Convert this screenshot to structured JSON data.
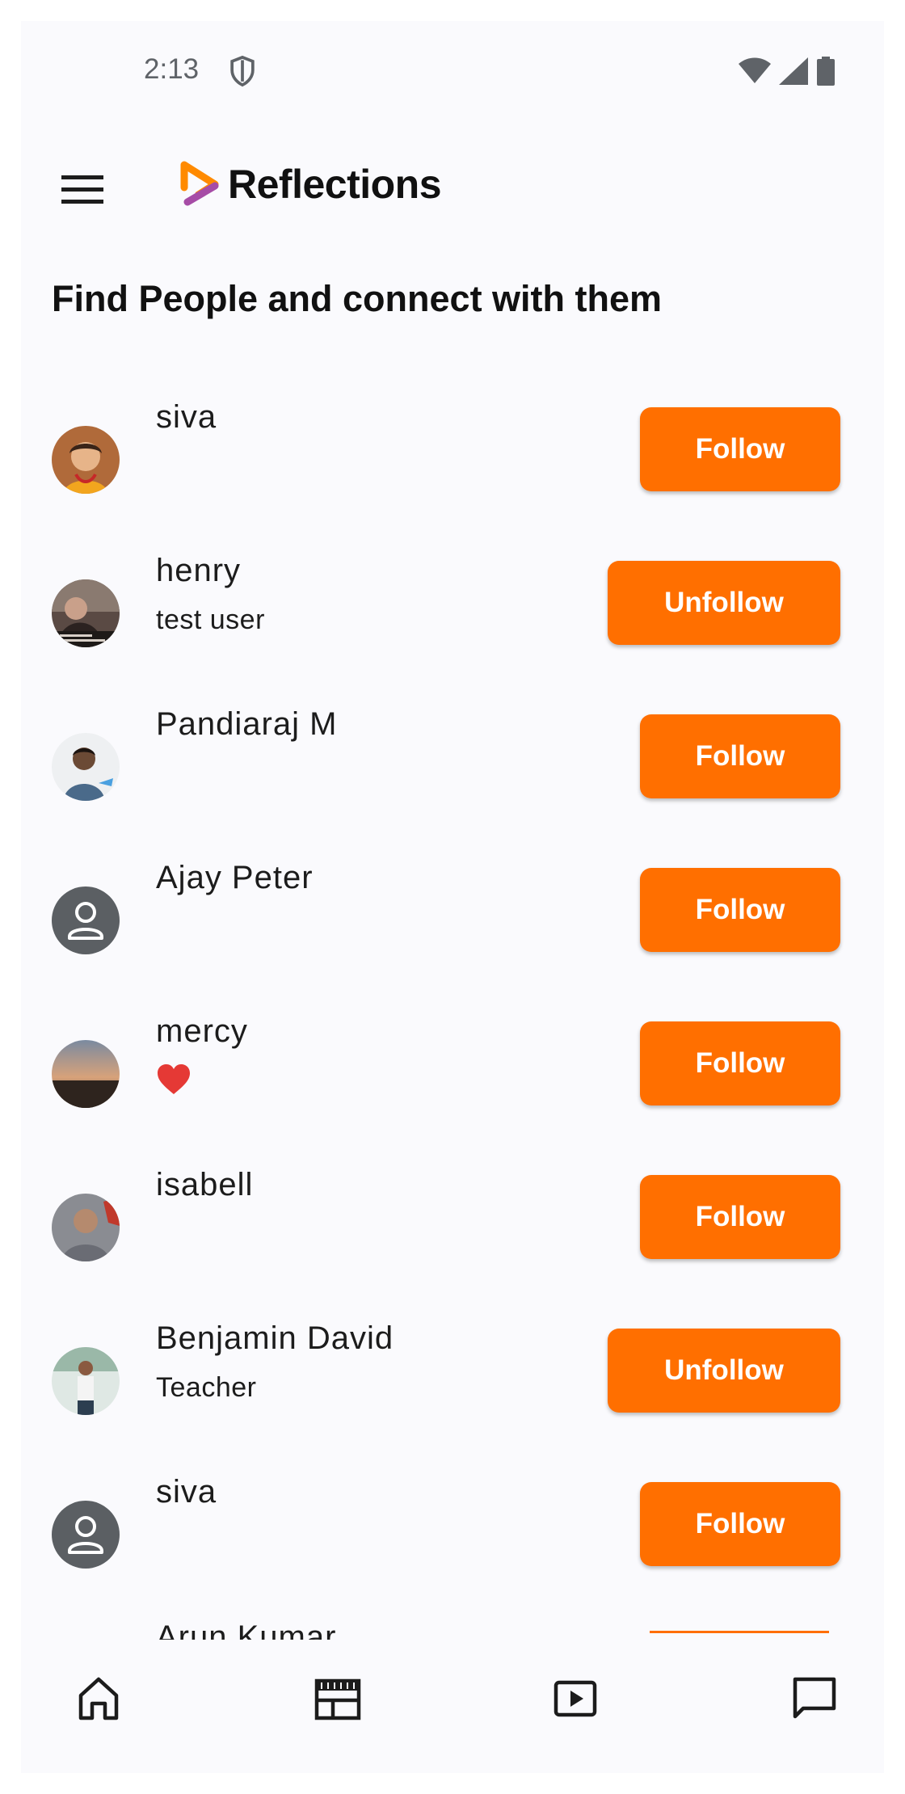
{
  "status_bar": {
    "time": "2:13",
    "icons": [
      "shield-icon",
      "wifi-icon",
      "signal-icon",
      "battery-icon"
    ]
  },
  "app_bar": {
    "title": "Reflections",
    "menu_icon": "menu-icon",
    "logo_colors": [
      "#ff8a00",
      "#a64ca6"
    ]
  },
  "page": {
    "heading": "Find People and connect with them"
  },
  "people": [
    {
      "name": "siva",
      "subtitle": "",
      "action": "Follow",
      "avatar": "photo"
    },
    {
      "name": "henry",
      "subtitle": "test user",
      "action": "Unfollow",
      "avatar": "photo"
    },
    {
      "name": "Pandiaraj M",
      "subtitle": "",
      "action": "Follow",
      "avatar": "photo"
    },
    {
      "name": "Ajay Peter",
      "subtitle": "",
      "action": "Follow",
      "avatar": "placeholder"
    },
    {
      "name": "mercy",
      "subtitle": "❤️",
      "action": "Follow",
      "avatar": "photo"
    },
    {
      "name": "isabell",
      "subtitle": "",
      "action": "Follow",
      "avatar": "photo"
    },
    {
      "name": "Benjamin David",
      "subtitle": "Teacher",
      "action": "Unfollow",
      "avatar": "photo"
    },
    {
      "name": "siva",
      "subtitle": "",
      "action": "Follow",
      "avatar": "placeholder"
    },
    {
      "name": "Arun Kumar",
      "subtitle": "",
      "action": "",
      "avatar": ""
    }
  ],
  "bottom_nav": {
    "items": [
      "home-icon",
      "feed-icon",
      "video-icon",
      "chat-icon"
    ]
  },
  "colors": {
    "accent": "#ff6f00",
    "background": "#fafafd",
    "text": "#1c1c1c"
  }
}
